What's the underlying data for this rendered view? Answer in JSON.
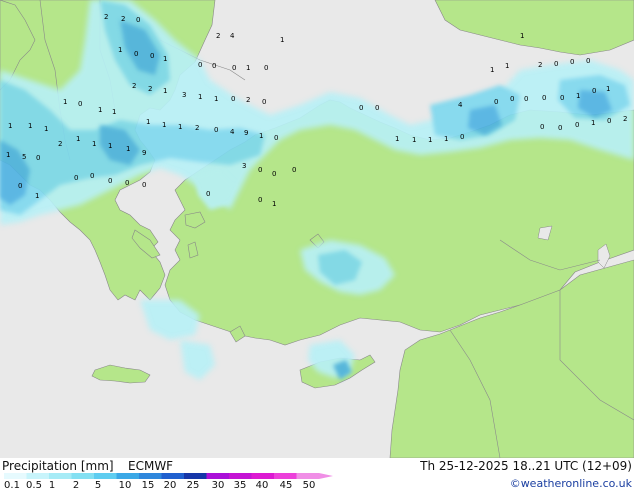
{
  "map": {
    "sea_color": "#e9e9e9",
    "land_color": "#b5e68a",
    "precip_light_color": "#b8f0f6",
    "precip_mid_color": "#7fd8ee",
    "precip_heavy_color": "#4fb2e2",
    "precip_values": [
      "2",
      "2",
      "0",
      "2",
      "4",
      "1",
      "1",
      "0",
      "0",
      "1",
      "0",
      "0",
      "0",
      "1",
      "0",
      "2",
      "2",
      "1",
      "3",
      "1",
      "1",
      "0",
      "2",
      "0",
      "1",
      "0",
      "1",
      "1",
      "1",
      "1",
      "1",
      "1",
      "1",
      "1",
      "2",
      "0",
      "4",
      "9",
      "1",
      "0",
      "1",
      "5",
      "0",
      "2",
      "1",
      "1",
      "1",
      "1",
      "9",
      "0",
      "1",
      "0",
      "0",
      "0",
      "0",
      "0",
      "0",
      "0",
      "1",
      "1",
      "1",
      "1",
      "0",
      "4",
      "0",
      "0",
      "0",
      "0",
      "0",
      "1",
      "0",
      "1",
      "1",
      "1",
      "1",
      "2",
      "0",
      "0",
      "0",
      "0",
      "0",
      "0",
      "1",
      "0",
      "2",
      "3",
      "0",
      "0",
      "0",
      "0",
      "0",
      "1",
      "0",
      "0"
    ]
  },
  "legend": {
    "title": "Precipitation [mm]",
    "model": "ECMWF",
    "ticks": [
      "0.1",
      "0.5",
      "1",
      "2",
      "5",
      "10",
      "15",
      "20",
      "25",
      "30",
      "35",
      "40",
      "45",
      "50"
    ],
    "colors": [
      "#e6fafe",
      "#c8f4fb",
      "#a6ebf6",
      "#84e0f2",
      "#5fcdf0",
      "#3ba8e6",
      "#2f87dc",
      "#2060cf",
      "#1636a8",
      "#aa10d8",
      "#c414d4",
      "#dc1ad2",
      "#ec40da",
      "#f08ee6"
    ],
    "datetime": "Th 25-12-2025 18..21 UTC (12+09)",
    "credit": "©weatheronline.co.uk"
  }
}
